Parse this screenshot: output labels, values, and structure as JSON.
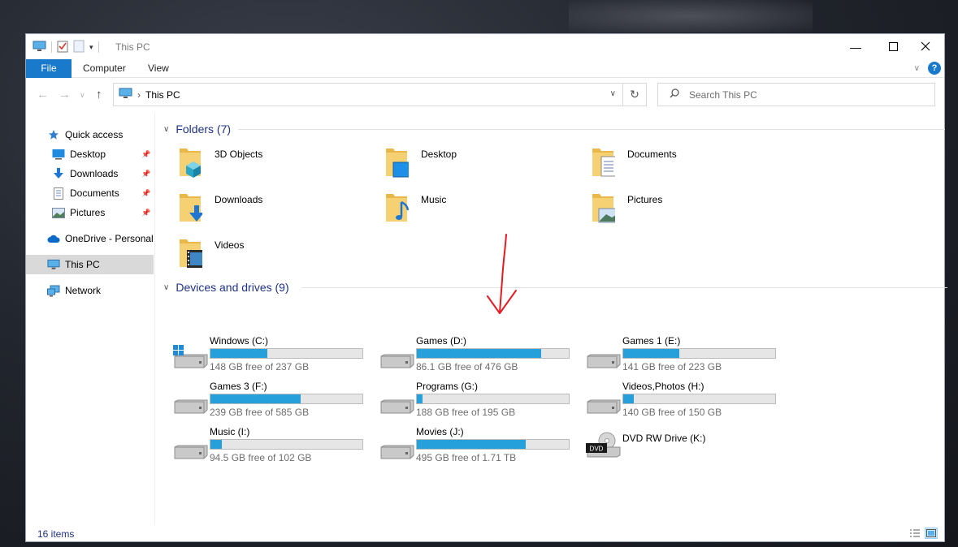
{
  "window": {
    "title": "This PC",
    "colors": {
      "accent": "#1979ca",
      "bar_fill": "#26a0da",
      "group_header": "#1e3287",
      "annotation": "#e11b22"
    }
  },
  "ribbon": {
    "tabs": [
      "File",
      "Computer",
      "View"
    ]
  },
  "address": {
    "path": "This PC",
    "separator": "›"
  },
  "search": {
    "placeholder": "Search This PC"
  },
  "nav_pane": {
    "items": [
      {
        "label": "Quick access",
        "icon": "star-icon"
      },
      {
        "label": "Desktop",
        "icon": "desktop-icon",
        "pinned": true
      },
      {
        "label": "Downloads",
        "icon": "download-icon",
        "pinned": true
      },
      {
        "label": "Documents",
        "icon": "document-icon",
        "pinned": true
      },
      {
        "label": "Pictures",
        "icon": "picture-icon",
        "pinned": true
      },
      {
        "label": "OneDrive - Personal",
        "icon": "cloud-icon"
      },
      {
        "label": "This PC",
        "icon": "computer-icon",
        "selected": true
      },
      {
        "label": "Network",
        "icon": "network-icon"
      }
    ]
  },
  "folders": {
    "header": "Folders (7)",
    "items": [
      {
        "label": "3D Objects",
        "icon": "3d-objects-folder-icon"
      },
      {
        "label": "Desktop",
        "icon": "desktop-folder-icon"
      },
      {
        "label": "Documents",
        "icon": "documents-folder-icon"
      },
      {
        "label": "Downloads",
        "icon": "downloads-folder-icon"
      },
      {
        "label": "Music",
        "icon": "music-folder-icon"
      },
      {
        "label": "Pictures",
        "icon": "pictures-folder-icon"
      },
      {
        "label": "Videos",
        "icon": "videos-folder-icon"
      }
    ]
  },
  "drives": {
    "header": "Devices and drives (9)",
    "items": [
      {
        "label": "Windows (C:)",
        "free": "148 GB free of 237 GB",
        "used_fraction": 0.376,
        "icon": "windows-drive-icon"
      },
      {
        "label": "Games (D:)",
        "free": "86.1 GB free of 476 GB",
        "used_fraction": 0.819,
        "icon": "hard-drive-icon"
      },
      {
        "label": "Games 1 (E:)",
        "free": "141 GB free of 223 GB",
        "used_fraction": 0.368,
        "icon": "hard-drive-icon"
      },
      {
        "label": "Games 3 (F:)",
        "free": "239 GB free of 585 GB",
        "used_fraction": 0.591,
        "icon": "hard-drive-icon"
      },
      {
        "label": "Programs (G:)",
        "free": "188 GB free of 195 GB",
        "used_fraction": 0.036,
        "icon": "hard-drive-icon"
      },
      {
        "label": "Videos,Photos (H:)",
        "free": "140 GB free of 150 GB",
        "used_fraction": 0.067,
        "icon": "hard-drive-icon"
      },
      {
        "label": "Music (I:)",
        "free": "94.5 GB free of 102 GB",
        "used_fraction": 0.074,
        "icon": "hard-drive-icon"
      },
      {
        "label": "Movies (J:)",
        "free": "495 GB free of 1.71 TB",
        "used_fraction": 0.717,
        "icon": "hard-drive-icon"
      },
      {
        "label": "DVD RW Drive (K:)",
        "free": "",
        "used_fraction": null,
        "icon": "dvd-drive-icon",
        "badge": "DVD"
      }
    ]
  },
  "status": {
    "count": "16 items"
  }
}
